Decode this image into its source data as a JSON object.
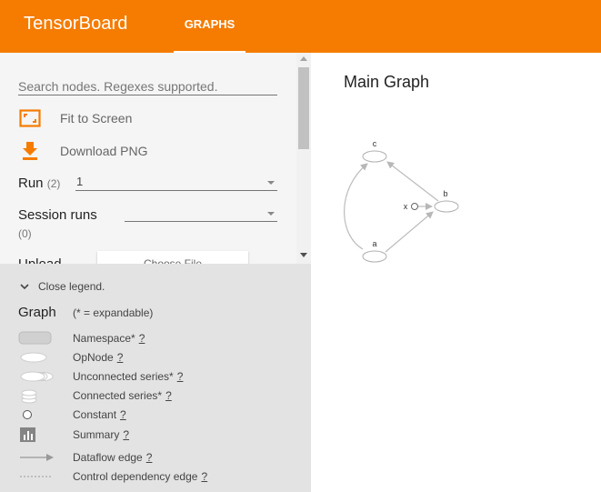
{
  "header": {
    "app_title": "TensorBoard",
    "tabs": [
      {
        "label": "GRAPHS",
        "active": true
      }
    ]
  },
  "sidebar": {
    "search": {
      "placeholder": "Search nodes. Regexes supported.",
      "value": ""
    },
    "fit_to_screen": "Fit to Screen",
    "download_png": "Download PNG",
    "run": {
      "label": "Run",
      "count": "(2)",
      "value": "1"
    },
    "session_runs": {
      "label": "Session runs",
      "count": "(0)",
      "value": ""
    },
    "upload": {
      "label": "Upload",
      "button": "Choose File"
    }
  },
  "legend": {
    "toggle_label": "Close legend.",
    "title": "Graph",
    "subtitle": "(* = expandable)",
    "help": "?",
    "items": [
      {
        "label": "Namespace*"
      },
      {
        "label": "OpNode"
      },
      {
        "label": "Unconnected series*"
      },
      {
        "label": "Connected series*"
      },
      {
        "label": "Constant"
      },
      {
        "label": "Summary"
      },
      {
        "label": "Dataflow edge"
      },
      {
        "label": "Control dependency edge"
      }
    ]
  },
  "main": {
    "title": "Main Graph",
    "nodes": {
      "c": "c",
      "b": "b",
      "x": "x",
      "a": "a"
    }
  },
  "colors": {
    "header_bg": "#f57c00",
    "accent_icon": "#f57c00",
    "sidebar_bg": "#f5f5f5",
    "legend_bg": "#e3e3e3",
    "graph_stroke": "#b7b7b7"
  }
}
